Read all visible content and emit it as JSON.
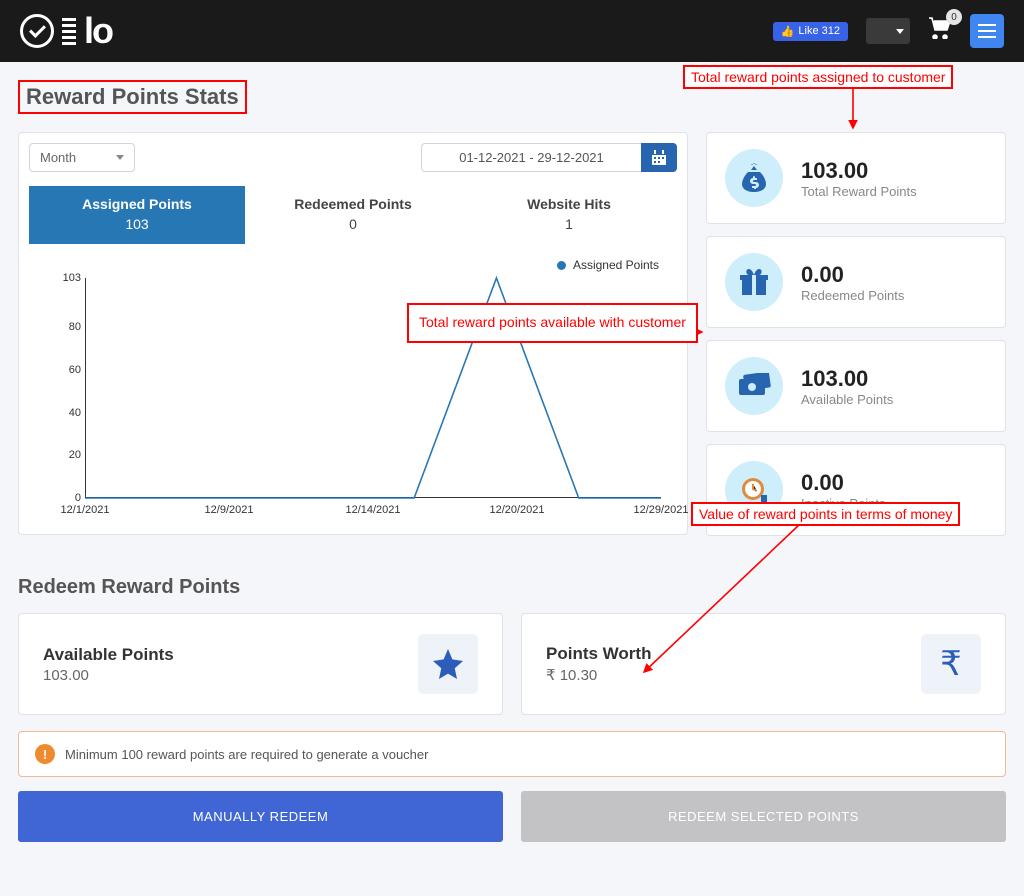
{
  "topbar": {
    "logo_text": "lo",
    "fb_like": "Like 312",
    "cart_count": "0"
  },
  "page_title": "Reward Points Stats",
  "annotations": {
    "a1": "Total reward points assigned to customer",
    "a2": "Total reward points available with customer",
    "a3": "Value of reward points in terms of money"
  },
  "filter": {
    "period": "Month",
    "daterange": "01-12-2021 - 29-12-2021"
  },
  "tabs": [
    {
      "label": "Assigned Points",
      "value": "103"
    },
    {
      "label": "Redeemed Points",
      "value": "0"
    },
    {
      "label": "Website Hits",
      "value": "1"
    }
  ],
  "chart_data": {
    "type": "line",
    "title": "",
    "legend": "Assigned Points",
    "xlabel": "",
    "ylabel": "",
    "ylim": [
      0,
      103
    ],
    "yticks": [
      0,
      20,
      40,
      60,
      80,
      103
    ],
    "xticks": [
      "12/1/2021",
      "12/9/2021",
      "12/14/2021",
      "12/20/2021",
      "12/29/2021"
    ],
    "series": [
      {
        "name": "Assigned Points",
        "x": [
          "12/1/2021",
          "12/9/2021",
          "12/14/2021",
          "12/20/2021",
          "12/26/2021",
          "12/27/2021",
          "12/28/2021",
          "12/29/2021"
        ],
        "y": [
          0,
          0,
          0,
          0,
          0,
          103,
          0,
          0
        ]
      }
    ]
  },
  "stats": {
    "total": {
      "value": "103.00",
      "label": "Total Reward Points"
    },
    "redeemed": {
      "value": "0.00",
      "label": "Redeemed Points"
    },
    "available": {
      "value": "103.00",
      "label": "Available Points"
    },
    "inactive": {
      "value": "0.00",
      "label": "Inactive Points"
    }
  },
  "redeem_section_title": "Redeem Reward Points",
  "redeem": {
    "available": {
      "label": "Available Points",
      "value": "103.00"
    },
    "worth": {
      "label": "Points Worth",
      "value": "₹ 10.30"
    }
  },
  "info_msg": "Minimum 100 reward points are required to generate a voucher",
  "buttons": {
    "manual": "MANUALLY REDEEM",
    "selected": "REDEEM SELECTED POINTS"
  }
}
